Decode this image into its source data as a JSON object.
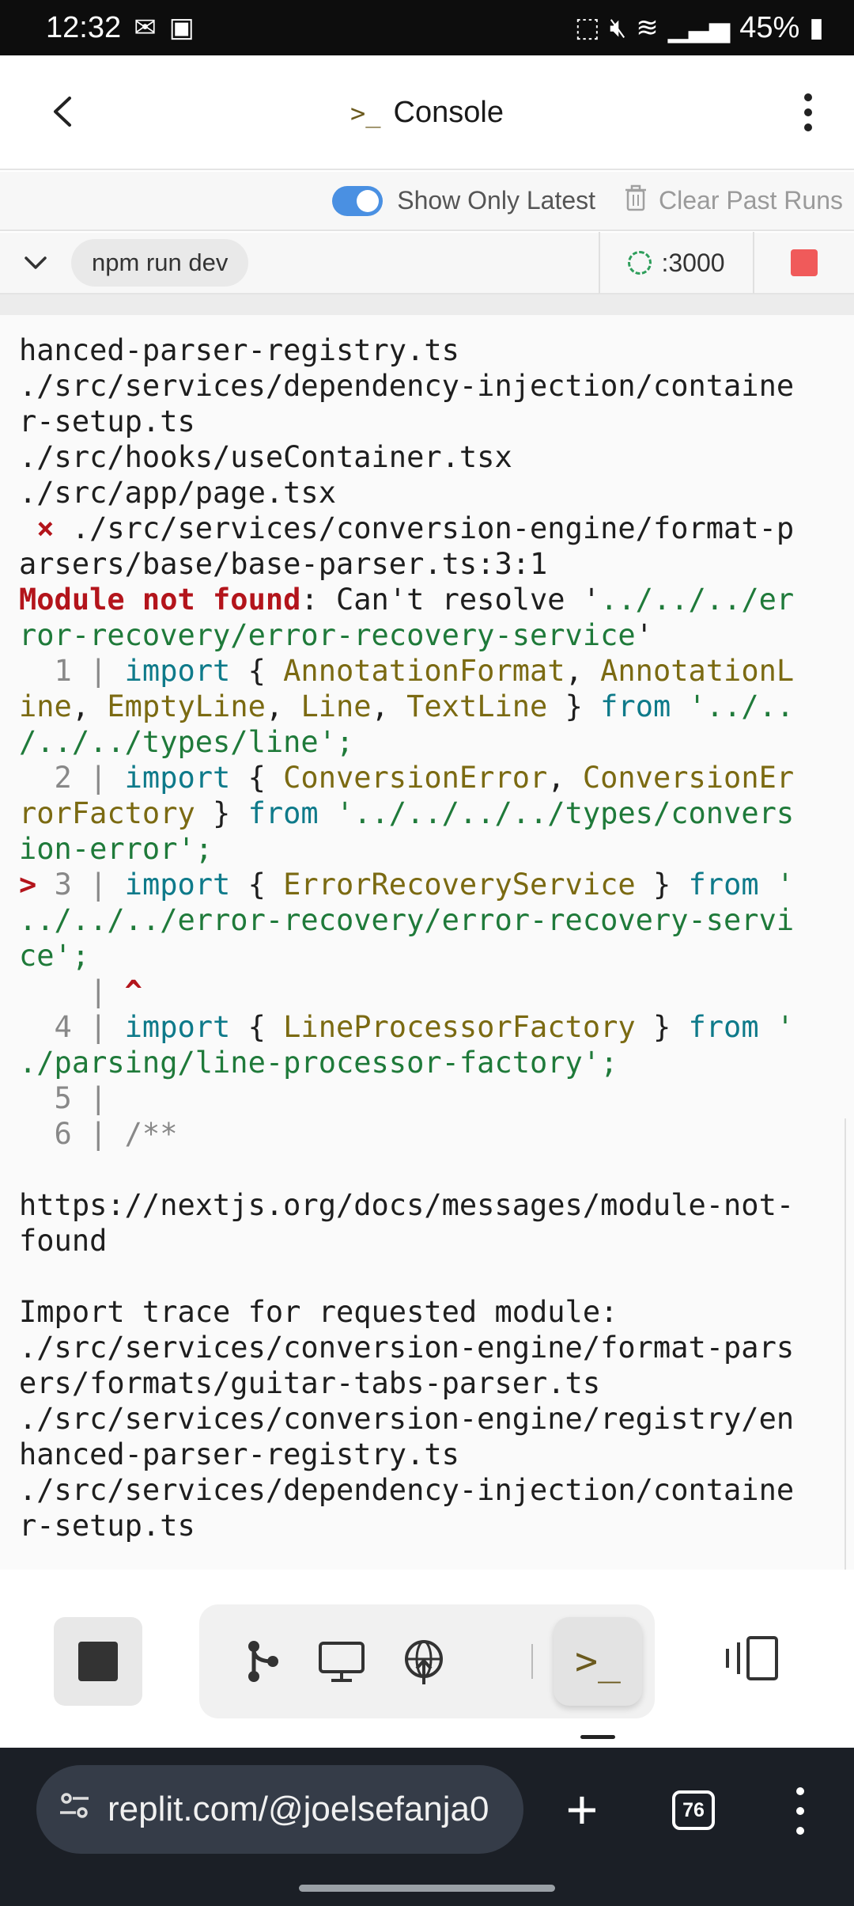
{
  "status_bar": {
    "time": "12:32",
    "battery": "45%"
  },
  "header": {
    "title": "Console"
  },
  "toolbar": {
    "show_only_latest": "Show Only Latest",
    "clear_past_runs": "Clear Past Runs"
  },
  "run": {
    "command": "npm run dev",
    "port": ":3000"
  },
  "console": {
    "l1": "hanced-parser-registry.ts",
    "l2": "./src/services/dependency-injection/containe",
    "l3": "r-setup.ts",
    "l4": "./src/hooks/useContainer.tsx",
    "l5": "./src/app/page.tsx",
    "l6a": " ×",
    "l6b": " ./src/services/conversion-engine/format-p",
    "l7": "arsers/base/base-parser.ts:3:1",
    "l8a": "Module not found",
    "l8b": ": Can't resolve '",
    "l8c": "../../../er",
    "l9a": "ror-recovery/error-recovery-service",
    "l9b": "'",
    "l10a": "  1 | ",
    "l10b": "import",
    "l10c": " { ",
    "l10d": "AnnotationFormat",
    "l10e": ", ",
    "l10f": "AnnotationL",
    "l11a": "ine",
    "l11b": ", ",
    "l11c": "EmptyLine",
    "l11d": ", ",
    "l11e": "Line",
    "l11f": ", ",
    "l11g": "TextLine",
    "l11h": " } ",
    "l11i": "from",
    "l11j": " '../..",
    "l12": "/../../types/line';",
    "l13a": "  2 | ",
    "l13b": "import",
    "l13c": " { ",
    "l13d": "ConversionError",
    "l13e": ", ",
    "l13f": "ConversionEr",
    "l14a": "rorFactory",
    "l14b": " } ",
    "l14c": "from",
    "l14d": " '../../../../types/convers",
    "l15": "ion-error';",
    "l16a": "> ",
    "l16b": "3 | ",
    "l16c": "import",
    "l16d": " { ",
    "l16e": "ErrorRecoveryService",
    "l16f": " } ",
    "l16g": "from",
    "l16h": " '",
    "l17": "../../../error-recovery/error-recovery-servi",
    "l18": "ce';",
    "l19a": "    | ",
    "l19b": "^",
    "l20a": "  4 | ",
    "l20b": "import",
    "l20c": " { ",
    "l20d": "LineProcessorFactory",
    "l20e": " } ",
    "l20f": "from",
    "l20g": " '",
    "l21": "./parsing/line-processor-factory';",
    "l22": "  5 |",
    "l23a": "  6 | ",
    "l23b": "/**",
    "l24": "",
    "l25": "https://nextjs.org/docs/messages/module-not-",
    "l26": "found",
    "l27": "",
    "l28": "Import trace for requested module:",
    "l29": "./src/services/conversion-engine/format-pars",
    "l30": "ers/formats/guitar-tabs-parser.ts",
    "l31": "./src/services/conversion-engine/registry/en",
    "l32": "hanced-parser-registry.ts",
    "l33": "./src/services/dependency-injection/containe",
    "l34": "r-setup.ts"
  },
  "browser": {
    "url": "replit.com/@joelsefanja0",
    "tab_count": "76"
  }
}
